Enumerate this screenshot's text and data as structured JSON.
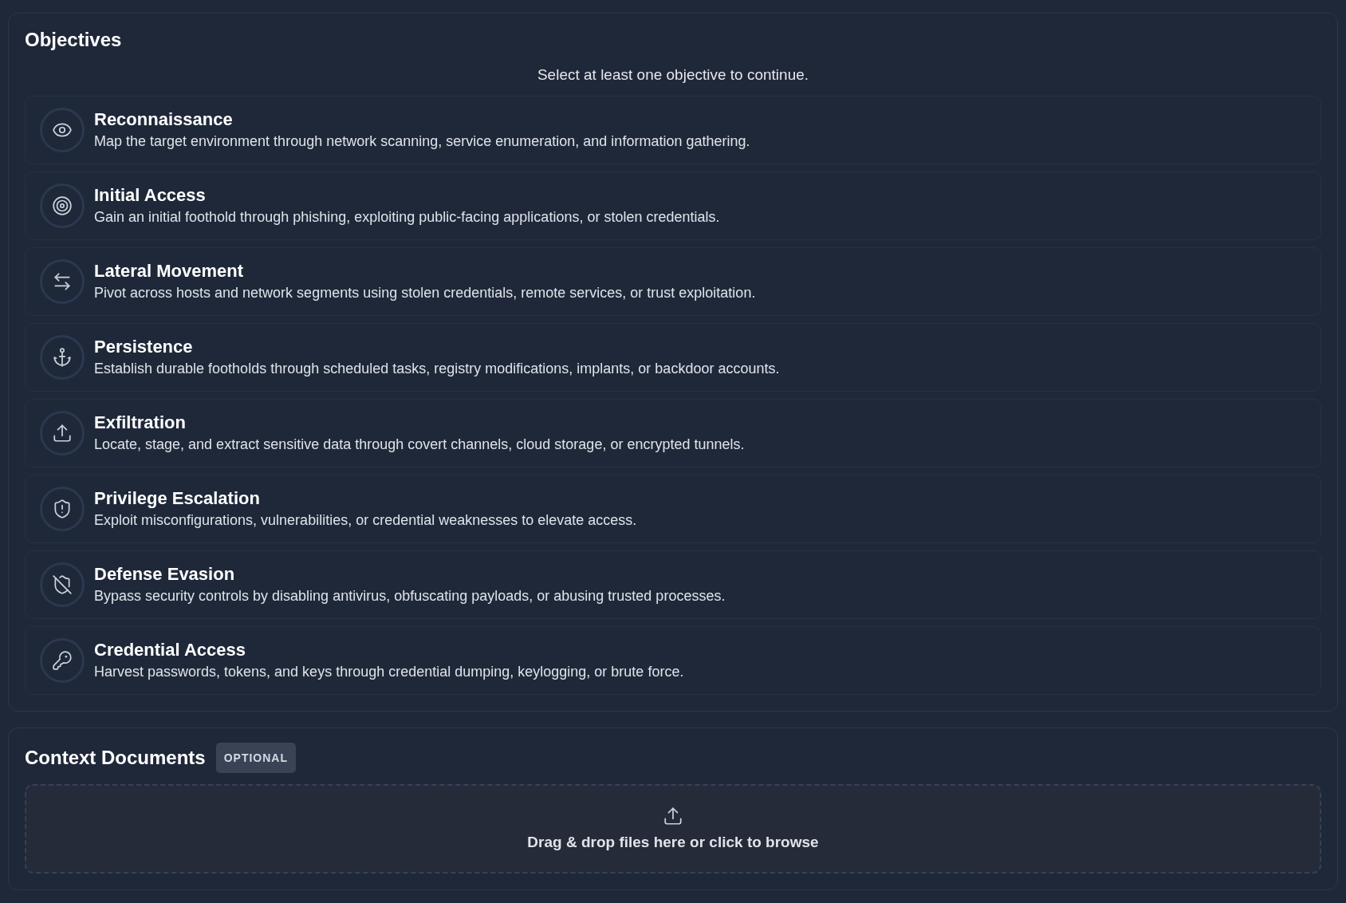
{
  "objectives": {
    "title": "Objectives",
    "hint": "Select at least one objective to continue.",
    "items": [
      {
        "kind": "eye",
        "title": "Reconnaissance",
        "description": "Map the target environment through network scanning, service enumeration, and information gathering."
      },
      {
        "kind": "target",
        "title": "Initial Access",
        "description": "Gain an initial foothold through phishing, exploiting public-facing applications, or stolen credentials."
      },
      {
        "kind": "arrows",
        "title": "Lateral Movement",
        "description": "Pivot across hosts and network segments using stolen credentials, remote services, or trust exploitation."
      },
      {
        "kind": "anchor",
        "title": "Persistence",
        "description": "Establish durable footholds through scheduled tasks, registry modifications, implants, or backdoor accounts."
      },
      {
        "kind": "upload",
        "title": "Exfiltration",
        "description": "Locate, stage, and extract sensitive data through covert channels, cloud storage, or encrypted tunnels."
      },
      {
        "kind": "shield-alert",
        "title": "Privilege Escalation",
        "description": "Exploit misconfigurations, vulnerabilities, or credential weaknesses to elevate access."
      },
      {
        "kind": "shield-off",
        "title": "Defense Evasion",
        "description": "Bypass security controls by disabling antivirus, obfuscating payloads, or abusing trusted processes."
      },
      {
        "kind": "key",
        "title": "Credential Access",
        "description": "Harvest passwords, tokens, and keys through credential dumping, keylogging, or brute force."
      }
    ]
  },
  "context_documents": {
    "title": "Context Documents",
    "badge": "OPTIONAL",
    "dropzone": {
      "label": "Drag & drop files here or click to browse"
    }
  }
}
